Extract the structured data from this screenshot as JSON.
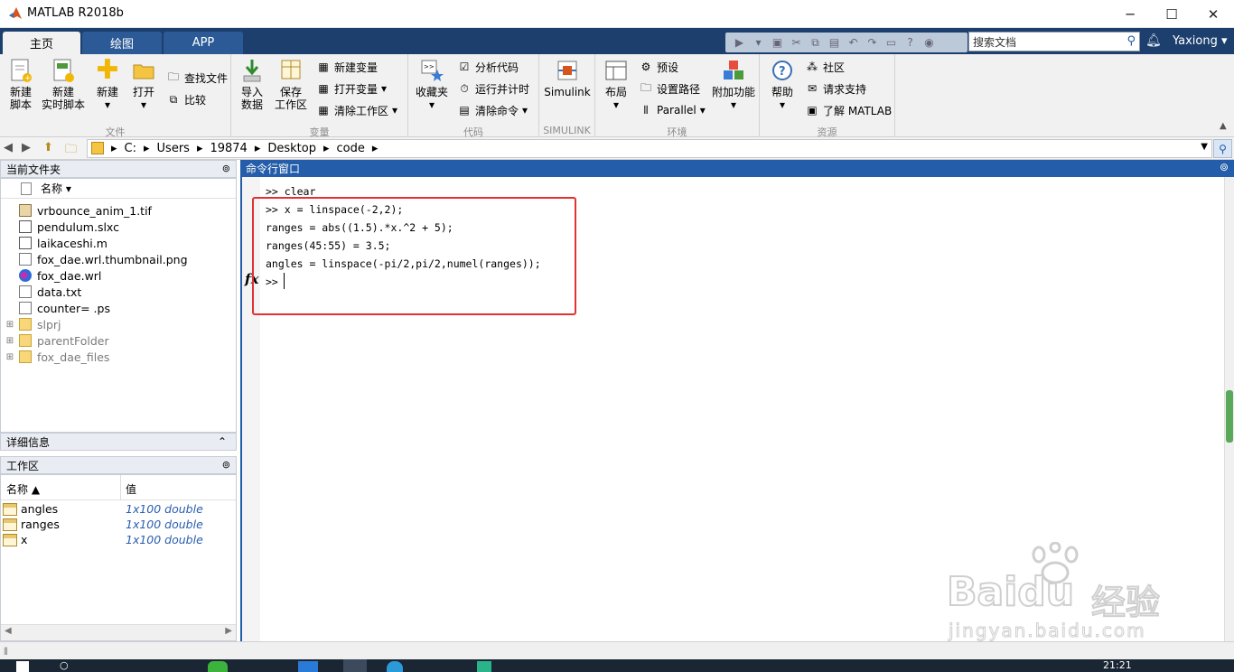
{
  "window": {
    "title": "MATLAB R2018b",
    "minimize": "─",
    "maximize": "☐",
    "close": "✕"
  },
  "tabs": [
    {
      "label": "主页"
    },
    {
      "label": "绘图"
    },
    {
      "label": "APP"
    }
  ],
  "search": {
    "placeholder": "搜索文档"
  },
  "user": {
    "name": "Yaxiong ▾"
  },
  "ribbon": {
    "file": {
      "label": "文件",
      "new_script": "新建\n脚本",
      "new_live_script": "新建\n实时脚本",
      "new": "新建",
      "open": "打开",
      "find_files": "查找文件",
      "compare": "比较"
    },
    "variable": {
      "label": "变量",
      "import": "导入\n数据",
      "save_ws": "保存\n工作区",
      "new_var": "新建变量",
      "open_var": "打开变量",
      "clear_ws": "清除工作区"
    },
    "code": {
      "label": "代码",
      "favorites": "收藏夹",
      "analyze": "分析代码",
      "run_time": "运行并计时",
      "clear_cmds": "清除命令"
    },
    "simulink": {
      "label": "SIMULINK",
      "simulink": "Simulink"
    },
    "env": {
      "label": "环境",
      "layout": "布局",
      "prefs": "预设",
      "set_path": "设置路径",
      "parallel": "Parallel",
      "addons": "附加功能"
    },
    "resources": {
      "label": "资源",
      "help": "帮助",
      "community": "社区",
      "support": "请求支持",
      "learn": "了解 MATLAB"
    }
  },
  "path": {
    "segments": [
      "C:",
      "Users",
      "19874",
      "Desktop",
      "code"
    ]
  },
  "current_folder": {
    "title": "当前文件夹",
    "column": "名称 ▾",
    "files": [
      {
        "name": "vrbounce_anim_1.tif",
        "icon": "image-file-icon",
        "folder": false
      },
      {
        "name": "pendulum.slxc",
        "icon": "simulink-cache-icon",
        "folder": false
      },
      {
        "name": "laikaceshi.m",
        "icon": "m-file-icon",
        "folder": false
      },
      {
        "name": "fox_dae.wrl.thumbnail.png",
        "icon": "blank-file-icon",
        "folder": false
      },
      {
        "name": "fox_dae.wrl",
        "icon": "vrml-file-icon",
        "folder": false
      },
      {
        "name": "data.txt",
        "icon": "text-file-icon",
        "folder": false
      },
      {
        "name": "counter= .ps",
        "icon": "blank-file-icon",
        "folder": false
      },
      {
        "name": "slprj",
        "icon": "folder-icon",
        "folder": true
      },
      {
        "name": "parentFolder",
        "icon": "folder-icon",
        "folder": true
      },
      {
        "name": "fox_dae_files",
        "icon": "folder-icon",
        "folder": true
      }
    ]
  },
  "details": {
    "title": "详细信息"
  },
  "workspace": {
    "title": "工作区",
    "col_name": "名称 ▲",
    "col_value": "值",
    "vars": [
      {
        "name": "angles",
        "value": "1x100 double"
      },
      {
        "name": "ranges",
        "value": "1x100 double"
      },
      {
        "name": "x",
        "value": "1x100 double"
      }
    ]
  },
  "command_window": {
    "title": "命令行窗口",
    "fx": "fx",
    "lines": [
      ">> clear",
      ">> x = linspace(-2,2);",
      "ranges = abs((1.5).*x.^2 + 5);",
      "ranges(45:55) = 3.5;",
      "angles = linspace(-pi/2,pi/2,numel(ranges));",
      ">> "
    ]
  },
  "taskbar": {
    "time": "21:21"
  },
  "watermark": {
    "brand": "Baidu",
    "cn": "经验",
    "url": "jingyan.baidu.com"
  },
  "colors": {
    "ribbon_tab_bg": "#1d3f6e",
    "accent_blue": "#245da9",
    "highlight_red": "#e23131"
  }
}
